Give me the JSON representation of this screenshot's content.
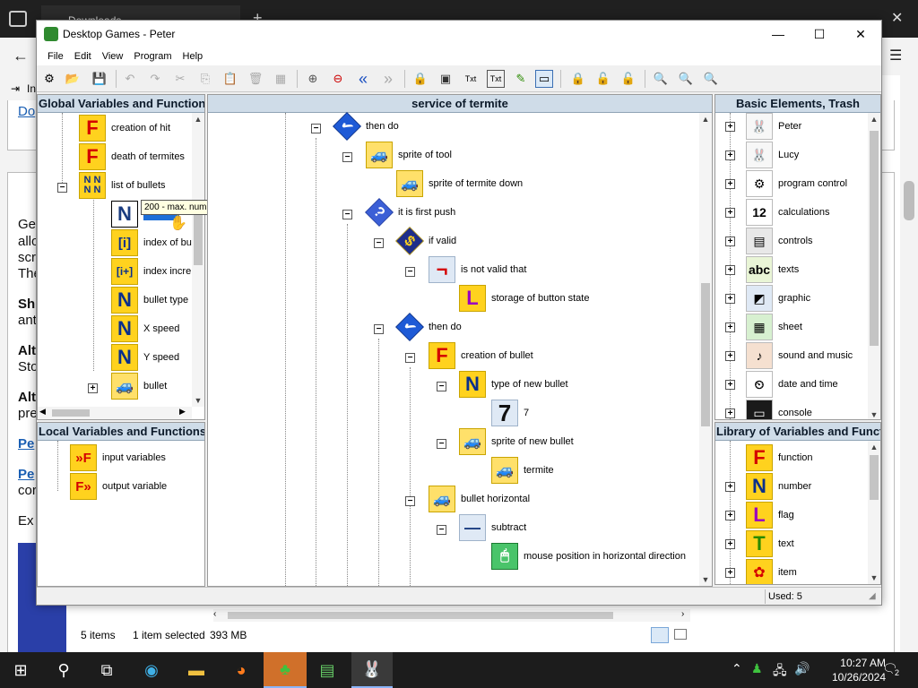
{
  "background": {
    "tab_title": "Downloads",
    "link1": "Do",
    "text_lines": [
      "Ge",
      "allo",
      "scr",
      "The"
    ],
    "bold1": "Sh",
    "bold1_line": "ant",
    "bold2": "Alt",
    "bold2_line": "Sto",
    "bold3": "Alt",
    "bold3_line": "pre",
    "link2": "Pe",
    "link3": "Pe",
    "link3_line": "cor",
    "ex_text": "Ex",
    "sidebar_label": "In",
    "status_items": "5 items",
    "status_selected": "1 item selected",
    "status_size": "393 MB"
  },
  "window": {
    "title": "Desktop Games - Peter",
    "minimize_glyph": "—",
    "maximize_glyph": "☐",
    "close_glyph": "✕",
    "menu": [
      "File",
      "Edit",
      "View",
      "Program",
      "Help"
    ]
  },
  "toolbar": {
    "icons": [
      "structure",
      "open",
      "save",
      "undo",
      "redo",
      "cut",
      "copy",
      "paste",
      "delete",
      "block",
      "zoom-in",
      "zoom-out",
      "prev",
      "next",
      "lock",
      "run",
      "text-tool",
      "text-list",
      "edit",
      "monitor",
      "lock-yellow-1",
      "lock-yellow-2",
      "lock-yellow-3",
      "find",
      "find-next",
      "find-replace"
    ],
    "glyphs": [
      "⚙",
      "📂",
      "💾",
      "↶",
      "↷",
      "✂",
      "⎘",
      "📋",
      "🗑",
      "▦",
      "⊕",
      "⊖",
      "«",
      "»",
      "🔒",
      "▣",
      "Txt",
      "Txt",
      "✎",
      "▭",
      "🔒",
      "🔓",
      "🔓",
      "🔍",
      "🔍",
      "🔍"
    ]
  },
  "panels": {
    "global": {
      "title": "Global Variables and Functions",
      "items": [
        {
          "label": "creation of hit",
          "icon": "F"
        },
        {
          "label": "death of termites",
          "icon": "F"
        },
        {
          "label": "list of bullets",
          "icon": "NN"
        },
        {
          "label": "",
          "icon": "N"
        },
        {
          "label": "index of bu",
          "icon": "[i]"
        },
        {
          "label": "index incre",
          "icon": "[i+]"
        },
        {
          "label": "bullet type",
          "icon": "N"
        },
        {
          "label": "X speed",
          "icon": "N"
        },
        {
          "label": "Y speed",
          "icon": "N"
        },
        {
          "label": "bullet",
          "icon": "car"
        }
      ],
      "tooltip": "200 - max. number of bullets"
    },
    "local": {
      "title": "Local Variables and Functions",
      "items": [
        {
          "label": "input variables",
          "icon": "»F"
        },
        {
          "label": "output variable",
          "icon": "F»"
        }
      ]
    },
    "service": {
      "title": "service of termite",
      "items": [
        {
          "label": "then do",
          "icon": "✔"
        },
        {
          "label": "sprite of tool",
          "icon": "car"
        },
        {
          "label": "sprite of termite down",
          "icon": "car"
        },
        {
          "label": "it is first push",
          "icon": "?"
        },
        {
          "label": "if valid",
          "icon": "$"
        },
        {
          "label": "is not valid that",
          "icon": "¬"
        },
        {
          "label": "storage of button state",
          "icon": "L"
        },
        {
          "label": "then do",
          "icon": "✔"
        },
        {
          "label": "creation of bullet",
          "icon": "F"
        },
        {
          "label": "type of new bullet",
          "icon": "N"
        },
        {
          "label": "7",
          "icon": "7"
        },
        {
          "label": "sprite of new bullet",
          "icon": "car"
        },
        {
          "label": "termite",
          "icon": "car"
        },
        {
          "label": "bullet horizontal",
          "icon": "car"
        },
        {
          "label": "subtract",
          "icon": "—"
        },
        {
          "label": "mouse position in horizontal direction",
          "icon": "mouse"
        }
      ]
    },
    "basic": {
      "title": "Basic Elements, Trash",
      "items": [
        {
          "label": "Peter",
          "icon": "🐰"
        },
        {
          "label": "Lucy",
          "icon": "🐰"
        },
        {
          "label": "program control",
          "icon": "⚙"
        },
        {
          "label": "calculations",
          "icon": "12"
        },
        {
          "label": "controls",
          "icon": "▤"
        },
        {
          "label": "texts",
          "icon": "abc"
        },
        {
          "label": "graphic",
          "icon": "◩"
        },
        {
          "label": "sheet",
          "icon": "▦"
        },
        {
          "label": "sound and music",
          "icon": "♪"
        },
        {
          "label": "date and time",
          "icon": "⏲"
        },
        {
          "label": "console",
          "icon": "▭"
        }
      ]
    },
    "library": {
      "title": "Library of Variables and Functions",
      "items": [
        {
          "label": "function",
          "icon": "F"
        },
        {
          "label": "number",
          "icon": "N"
        },
        {
          "label": "flag",
          "icon": "L"
        },
        {
          "label": "text",
          "icon": "T"
        },
        {
          "label": "item",
          "icon": "✿"
        }
      ],
      "used": "Used: 5"
    }
  },
  "taskbar": {
    "time": "10:27 AM",
    "date": "10/26/2024",
    "notifications": "2"
  }
}
